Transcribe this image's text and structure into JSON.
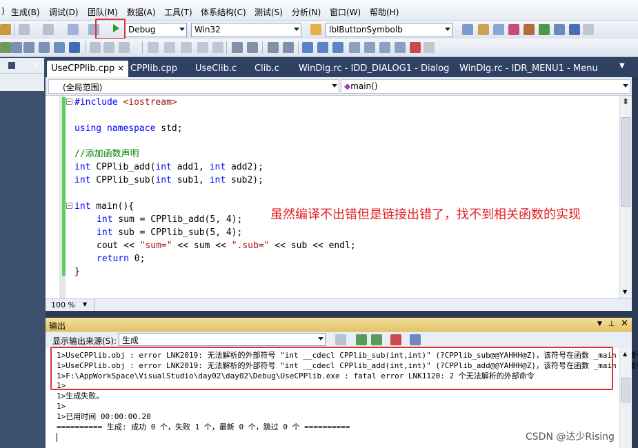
{
  "menu": {
    "items": [
      "生成(B)",
      "调试(D)",
      "团队(M)",
      "数据(A)",
      "工具(T)",
      "体系结构(C)",
      "测试(S)",
      "分析(N)",
      "窗口(W)",
      "帮助(H)"
    ],
    "first_fragment": ")"
  },
  "toolbar": {
    "config": "Debug",
    "platform": "Win32",
    "find_combo": "lblButtonSymbolb"
  },
  "tabs": [
    {
      "label": "UseCPPlib.cpp",
      "active": true
    },
    {
      "label": "CPPlib.cpp"
    },
    {
      "label": "UseClib.c"
    },
    {
      "label": "Clib.c"
    },
    {
      "label": "WinDlg.rc - IDD_DIALOG1 - Dialog"
    },
    {
      "label": "WinDlg.rc - IDR_MENU1 - Menu"
    }
  ],
  "nav": {
    "scope": "(全局范围)",
    "function": "main()"
  },
  "code": {
    "l1_kw": "#include",
    "l1_rest": " <iostream>",
    "l2_kw1": "using",
    "l2_kw2": "namespace",
    "l2_rest": " std;",
    "l3_comment": "//添加函数声明",
    "l4_kw": "int",
    "l4_a": " CPPlib_add(",
    "l4_kw2": "int",
    "l4_b": " add1, ",
    "l4_kw3": "int",
    "l4_c": " add2);",
    "l5_kw": "int",
    "l5_a": " CPPlib_sub(",
    "l5_kw2": "int",
    "l5_b": " sub1, ",
    "l5_kw3": "int",
    "l5_c": " sub2);",
    "l6_kw": "int",
    "l6_rest": " main(){",
    "l7_kw": "int",
    "l7_rest": " sum = CPPlib_add(5, 4);",
    "l8_kw": "int",
    "l8_rest": " sub = CPPlib_sub(5, 4);",
    "l9_a": "cout << ",
    "l9_s1": "\"sum=\"",
    "l9_b": " << sum << ",
    "l9_s2": "\".sub=\"",
    "l9_c": " << sub << endl;",
    "l10_kw": "return",
    "l10_rest": " 0;",
    "l11": "}"
  },
  "annotation": "虽然编译不出错但是链接出错了，找不到相关函数的实现",
  "zoom": "100 %",
  "output": {
    "title": "输出",
    "source_label": "显示输出来源(S):",
    "source_value": "生成",
    "lines": [
      "1>UseCPPlib.obj : error LNK2019: 无法解析的外部符号 \"int __cdecl CPPlib_sub(int,int)\" (?CPPlib_sub@@YAHHH@Z)，该符号在函数 _main 中被引",
      "1>UseCPPlib.obj : error LNK2019: 无法解析的外部符号 \"int __cdecl CPPlib_add(int,int)\" (?CPPlib_add@@YAHHH@Z)，该符号在函数 _main 中被引",
      "1>F:\\AppWorkSpace\\VisualStudio\\day02\\day02\\Debug\\UseCPPlib.exe : fatal error LNK1120: 2 个无法解析的外部命令",
      "1>",
      "1>生成失败。",
      "1>",
      "1>已用时间 00:00:00.20",
      "========== 生成: 成功 0 个，失败 1 个，最新 0 个，跳过 0 个 =========="
    ]
  },
  "watermark": "CSDN @达少Rising"
}
